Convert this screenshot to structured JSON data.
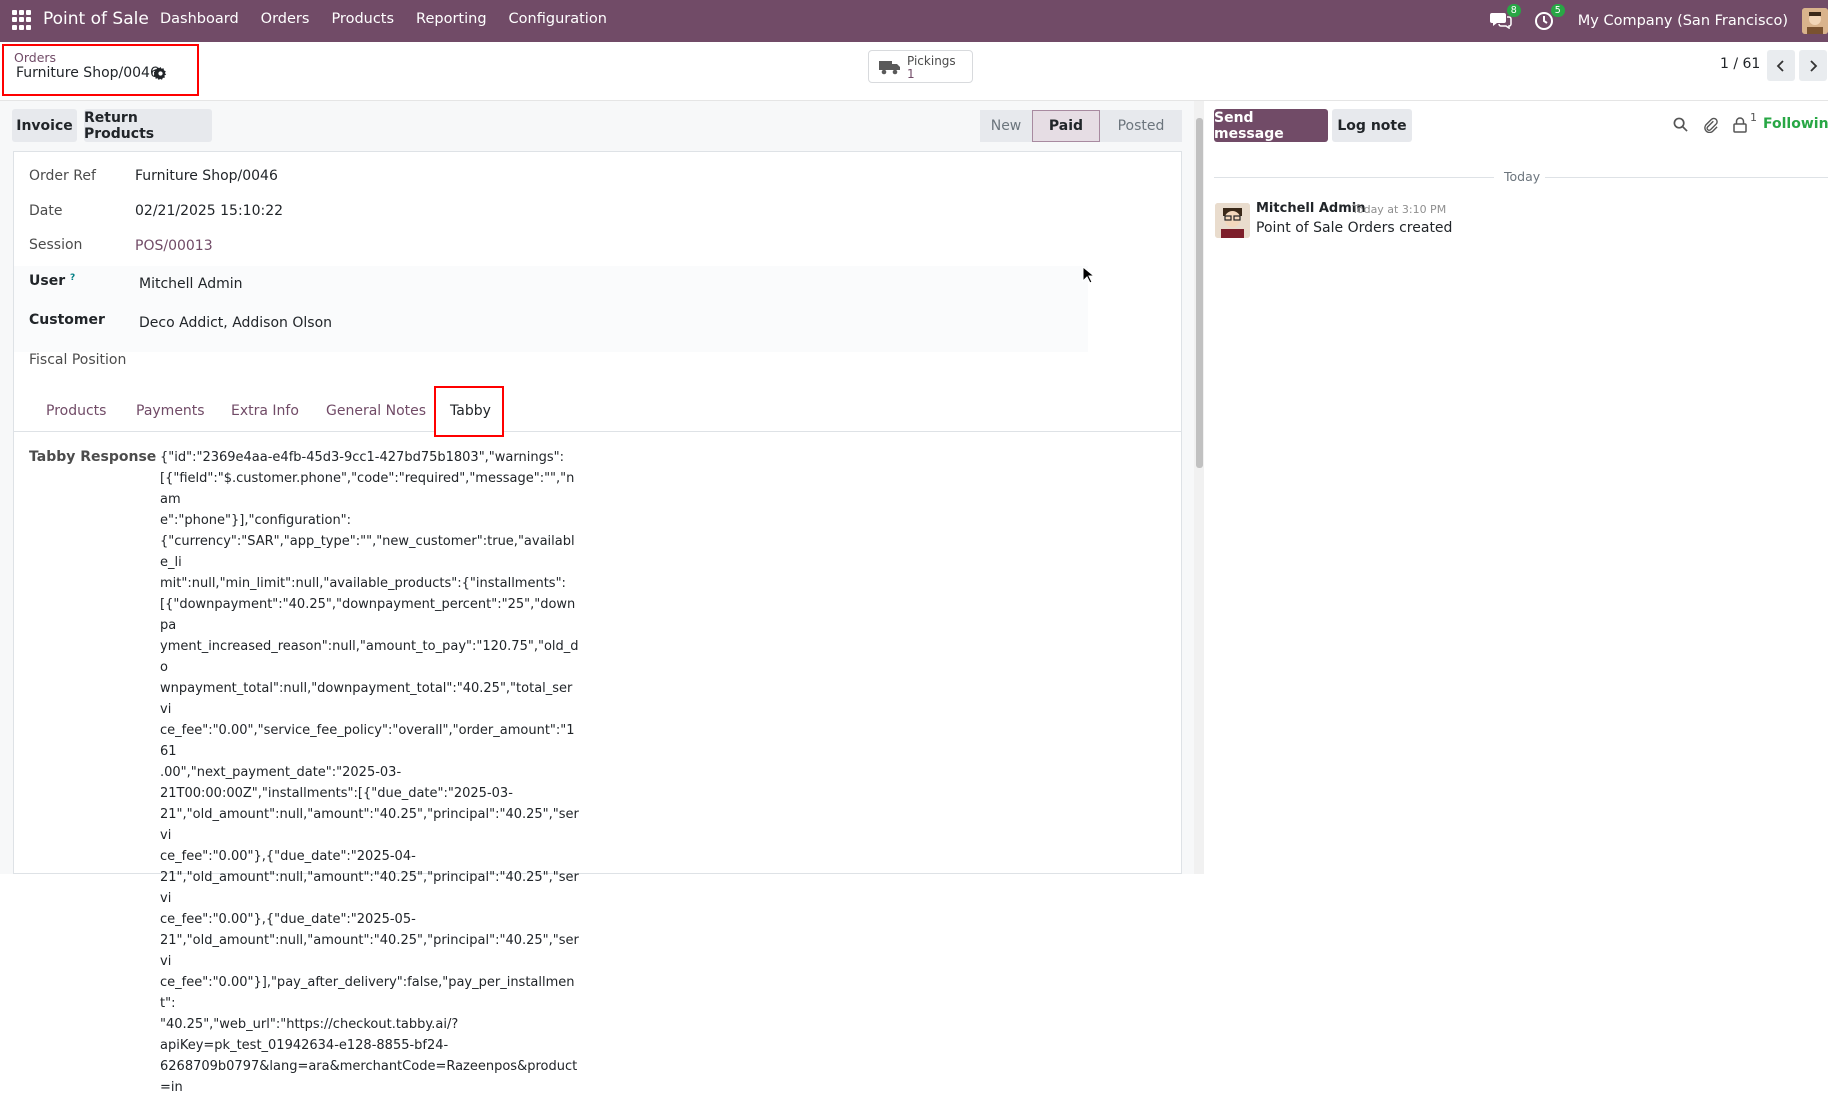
{
  "navbar": {
    "app_name": "Point of Sale",
    "menu": [
      "Dashboard",
      "Orders",
      "Products",
      "Reporting",
      "Configuration"
    ],
    "messages_count": "8",
    "activities_count": "5",
    "company": "My Company (San Francisco)"
  },
  "control_panel": {
    "breadcrumb_parent": "Orders",
    "breadcrumb_current": "Furniture Shop/0046",
    "pickings_label": "Pickings",
    "pickings_count": "1",
    "pager": "1 / 61"
  },
  "actions": {
    "invoice": "Invoice",
    "return_products": "Return Products"
  },
  "status": {
    "steps": [
      "New",
      "Paid",
      "Posted"
    ],
    "active": "Paid"
  },
  "form": {
    "order_ref_label": "Order Ref",
    "order_ref": "Furniture Shop/0046",
    "date_label": "Date",
    "date": "02/21/2025 15:10:22",
    "session_label": "Session",
    "session": "POS/00013",
    "user_label": "User",
    "user_help": "?",
    "user": "Mitchell Admin",
    "customer_label": "Customer",
    "customer": "Deco Addict, Addison Olson",
    "fiscal_position_label": "Fiscal Position"
  },
  "tabs": [
    "Products",
    "Payments",
    "Extra Info",
    "General Notes",
    "Tabby"
  ],
  "active_tab": "Tabby",
  "tabby": {
    "label": "Tabby Response",
    "response": "{\"id\":\"2369e4aa-e4fb-45d3-9cc1-427bd75b1803\",\"warnings\":\n[{\"field\":\"$.customer.phone\",\"code\":\"required\",\"message\":\"\",\"nam\ne\":\"phone\"}],\"configuration\":\n{\"currency\":\"SAR\",\"app_type\":\"\",\"new_customer\":true,\"available_li\nmit\":null,\"min_limit\":null,\"available_products\":{\"installments\":\n[{\"downpayment\":\"40.25\",\"downpayment_percent\":\"25\",\"downpa\nyment_increased_reason\":null,\"amount_to_pay\":\"120.75\",\"old_do\nwnpayment_total\":null,\"downpayment_total\":\"40.25\",\"total_servi\nce_fee\":\"0.00\",\"service_fee_policy\":\"overall\",\"order_amount\":\"161\n.00\",\"next_payment_date\":\"2025-03-\n21T00:00:00Z\",\"installments\":[{\"due_date\":\"2025-03-\n21\",\"old_amount\":null,\"amount\":\"40.25\",\"principal\":\"40.25\",\"servi\nce_fee\":\"0.00\"},{\"due_date\":\"2025-04-\n21\",\"old_amount\":null,\"amount\":\"40.25\",\"principal\":\"40.25\",\"servi\nce_fee\":\"0.00\"},{\"due_date\":\"2025-05-\n21\",\"old_amount\":null,\"amount\":\"40.25\",\"principal\":\"40.25\",\"servi\nce_fee\":\"0.00\"}],\"pay_after_delivery\":false,\"pay_per_installment\":\n\"40.25\",\"web_url\":\"https://checkout.tabby.ai/?\napiKey=pk_test_01942634-e128-8855-bf24-\n6268709b0797&lang=ara&merchantCode=Razeenpos&product=in"
  },
  "chatter": {
    "send_message": "Send message",
    "log_note": "Log note",
    "followers_count": "1",
    "following": "Following",
    "date_separator": "Today",
    "message": {
      "author": "Mitchell Admin",
      "date": "Today at 3:10 PM",
      "body": "Point of Sale Orders created"
    }
  },
  "colors": {
    "brand": "#714B67",
    "success": "#28a745",
    "highlight_box": "#ff0000"
  }
}
